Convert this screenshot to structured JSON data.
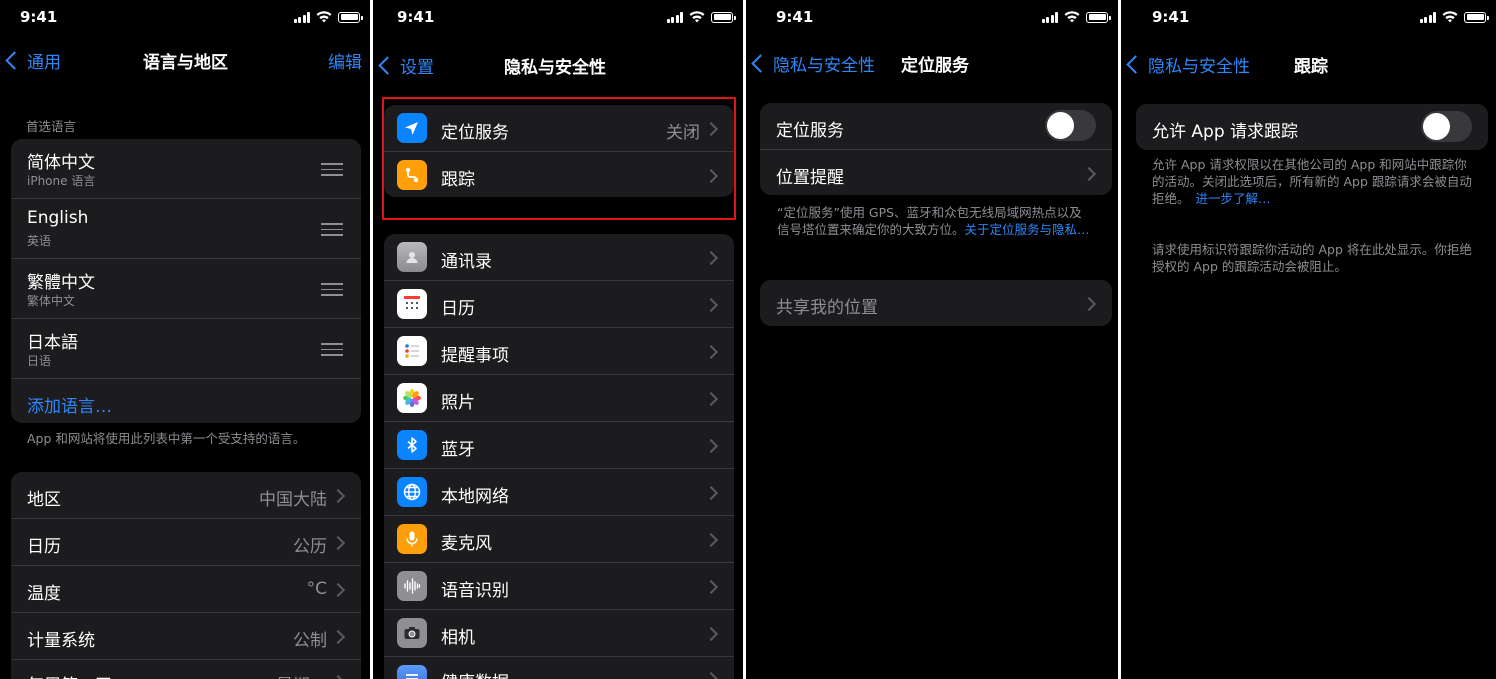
{
  "status": {
    "time": "9:41"
  },
  "screen1": {
    "back_label": "通用",
    "title": "语言与地区",
    "edit_label": "编辑",
    "section_header": "首选语言",
    "languages": [
      {
        "name": "简体中文",
        "sub": "iPhone 语言"
      },
      {
        "name": "English",
        "sub": "英语"
      },
      {
        "name": "繁體中文",
        "sub": "繁体中文"
      },
      {
        "name": "日本語",
        "sub": "日语"
      }
    ],
    "add_language": "添加语言…",
    "footnote": "App 和网站将使用此列表中第一个受支持的语言。",
    "settings": [
      {
        "label": "地区",
        "value": "中国大陆"
      },
      {
        "label": "日历",
        "value": "公历"
      },
      {
        "label": "温度",
        "value": "°C"
      },
      {
        "label": "计量系统",
        "value": "公制"
      },
      {
        "label": "每周第一天",
        "value": "星期一"
      }
    ]
  },
  "screen2": {
    "back_label": "设置",
    "title": "隐私与安全性",
    "top_items": [
      {
        "label": "定位服务",
        "value": "关闭",
        "icon": "location-arrow-icon",
        "color": "#0a84ff"
      },
      {
        "label": "跟踪",
        "value": "",
        "icon": "tracking-icon",
        "color": "#ff9f0a"
      }
    ],
    "items": [
      {
        "label": "通讯录",
        "icon": "contacts-icon",
        "color": "#9a9a9f"
      },
      {
        "label": "日历",
        "icon": "calendar-icon",
        "color": "#ffffff"
      },
      {
        "label": "提醒事项",
        "icon": "reminders-icon",
        "color": "#ffffff"
      },
      {
        "label": "照片",
        "icon": "photos-icon",
        "color": "#ffffff"
      },
      {
        "label": "蓝牙",
        "icon": "bluetooth-icon",
        "color": "#0a84ff"
      },
      {
        "label": "本地网络",
        "icon": "globe-icon",
        "color": "#0a84ff"
      },
      {
        "label": "麦克风",
        "icon": "microphone-icon",
        "color": "#ff9f0a"
      },
      {
        "label": "语音识别",
        "icon": "waveform-icon",
        "color": "#8e8e93"
      },
      {
        "label": "相机",
        "icon": "camera-icon",
        "color": "#8e8e93"
      },
      {
        "label": "健康数据",
        "icon": "health-icon",
        "color": "#3a7bd5"
      }
    ]
  },
  "screen3": {
    "back_label": "隐私与安全性",
    "title": "定位服务",
    "items": [
      {
        "label": "定位服务",
        "type": "toggle",
        "state": "off"
      },
      {
        "label": "位置提醒",
        "type": "chevron"
      }
    ],
    "footnote": "“定位服务”使用 GPS、蓝牙和众包无线局域网热点以及信号塔位置来确定你的大致方位。",
    "footnote_link": "关于定位服务与隐私…",
    "share_label": "共享我的位置"
  },
  "screen4": {
    "back_label": "隐私与安全性",
    "title": "跟踪",
    "toggle_label": "允许 App 请求跟踪",
    "toggle_state": "off",
    "footnote1": "允许 App 请求权限以在其他公司的 App 和网站中跟踪你的活动。关闭此选项后，所有新的 App 跟踪请求会被自动拒绝。",
    "footnote1_link": "进一步了解…",
    "footnote2": "请求使用标识符跟踪你活动的 App 将在此处显示。你拒绝授权的 App 的跟踪活动会被阻止。"
  }
}
